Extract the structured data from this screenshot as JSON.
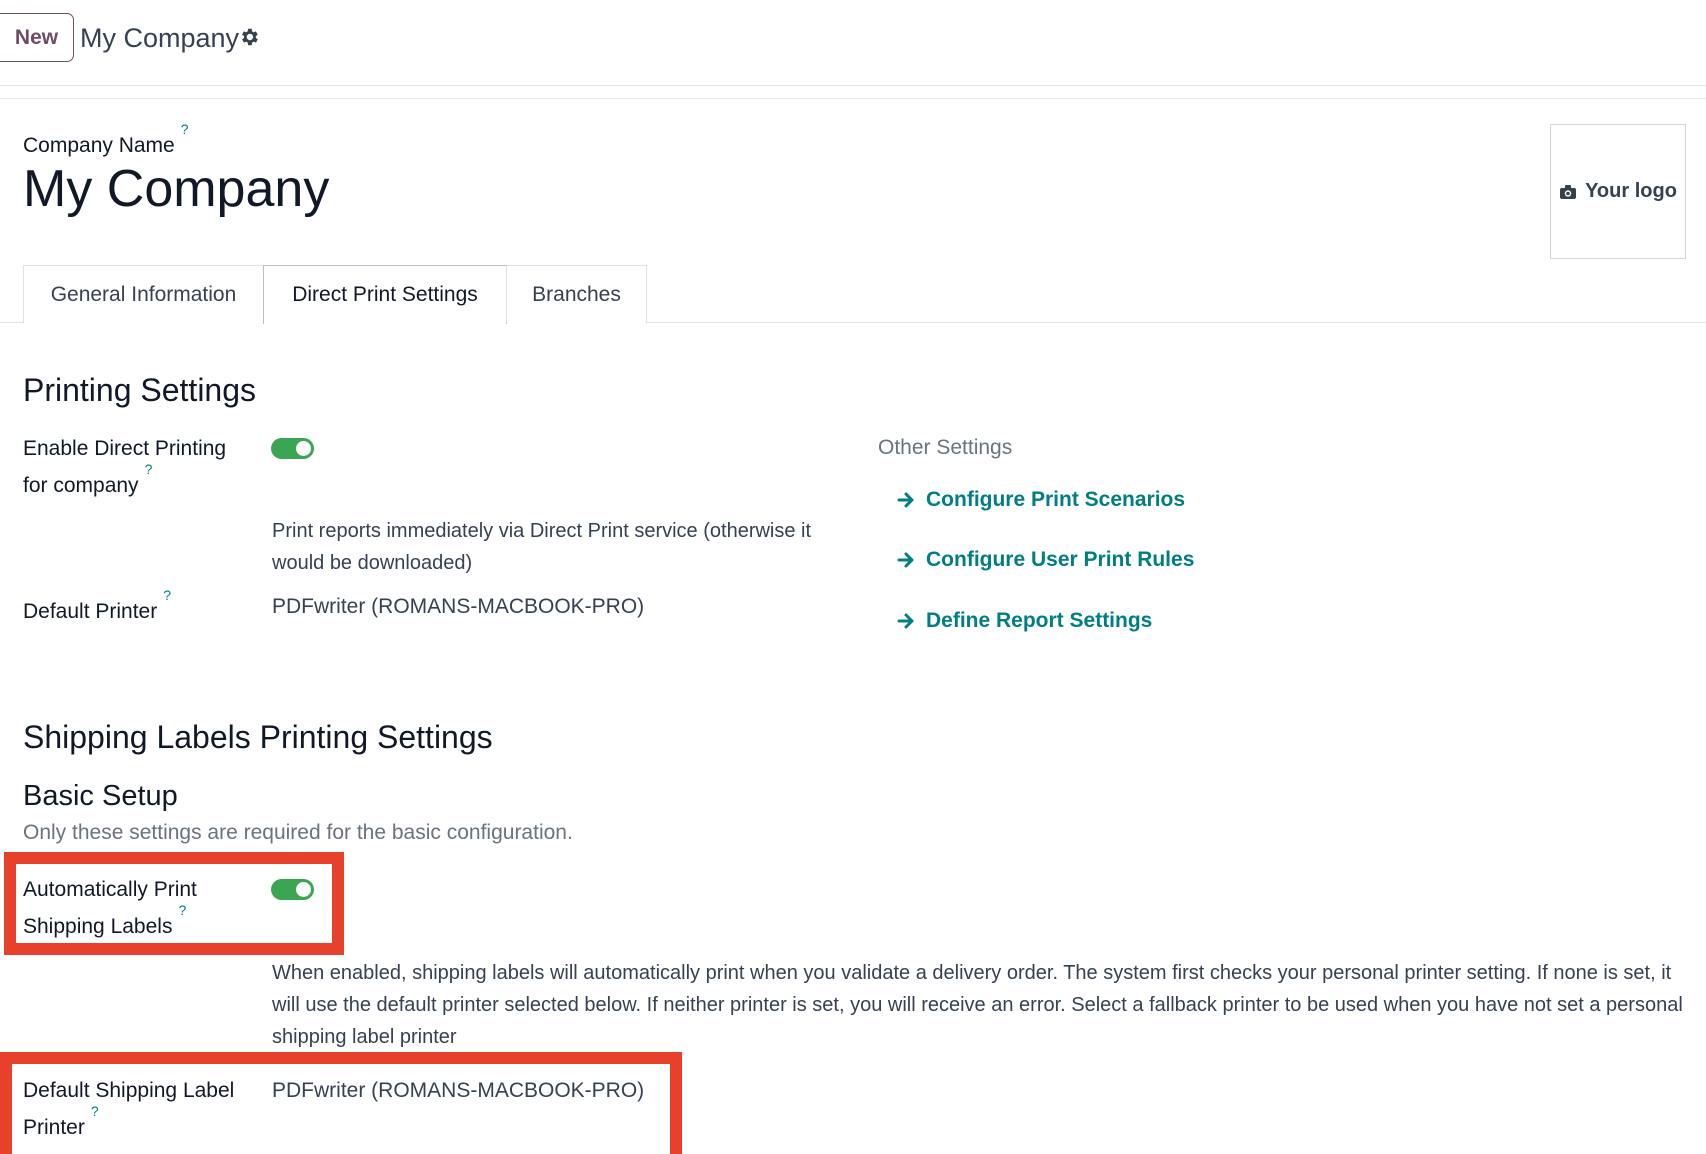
{
  "control_panel": {
    "new_label": "New",
    "breadcrumb_title": "My Company"
  },
  "header": {
    "company_name_label": "Company Name",
    "tooltip_mark": "?",
    "company_name_value": "My Company",
    "logo_label": "Your logo"
  },
  "tabs": [
    {
      "label": "General Information",
      "active": false
    },
    {
      "label": "Direct Print Settings",
      "active": true
    },
    {
      "label": "Branches",
      "active": false
    }
  ],
  "printing_settings": {
    "title": "Printing Settings",
    "enable_label_line1": "Enable Direct Printing",
    "enable_label_line2": "for company",
    "enable_value": true,
    "enable_help": "Print reports immediately via Direct Print service (otherwise it would be downloaded)",
    "default_printer_label": "Default Printer",
    "default_printer_value": "PDFwriter (ROMANS-MACBOOK-PRO)",
    "other_settings_label": "Other Settings",
    "links": [
      "Configure Print Scenarios",
      "Configure User Print Rules",
      "Define Report Settings"
    ]
  },
  "shipping": {
    "title": "Shipping Labels Printing Settings",
    "basic_setup_title": "Basic Setup",
    "basic_setup_desc": "Only these settings are required for the basic configuration.",
    "auto_print_label_line1": "Automatically Print",
    "auto_print_label_line2": "Shipping Labels",
    "auto_print_value": true,
    "auto_print_help": "When enabled, shipping labels will automatically print when you validate a delivery order. The system first checks your personal printer setting. If none is set, it will use the default printer selected below. If neither printer is set, you will receive an error. Select a fallback printer to be used when you have not set a personal shipping label printer",
    "default_label_printer_line1": "Default Shipping Label",
    "default_label_printer_line2": "Printer",
    "default_label_printer_value": "PDFwriter (ROMANS-MACBOOK-PRO)"
  },
  "colors": {
    "accent": "#714b67",
    "link": "#017e84",
    "toggle_on": "#3aa653",
    "highlight": "#e8412b"
  }
}
